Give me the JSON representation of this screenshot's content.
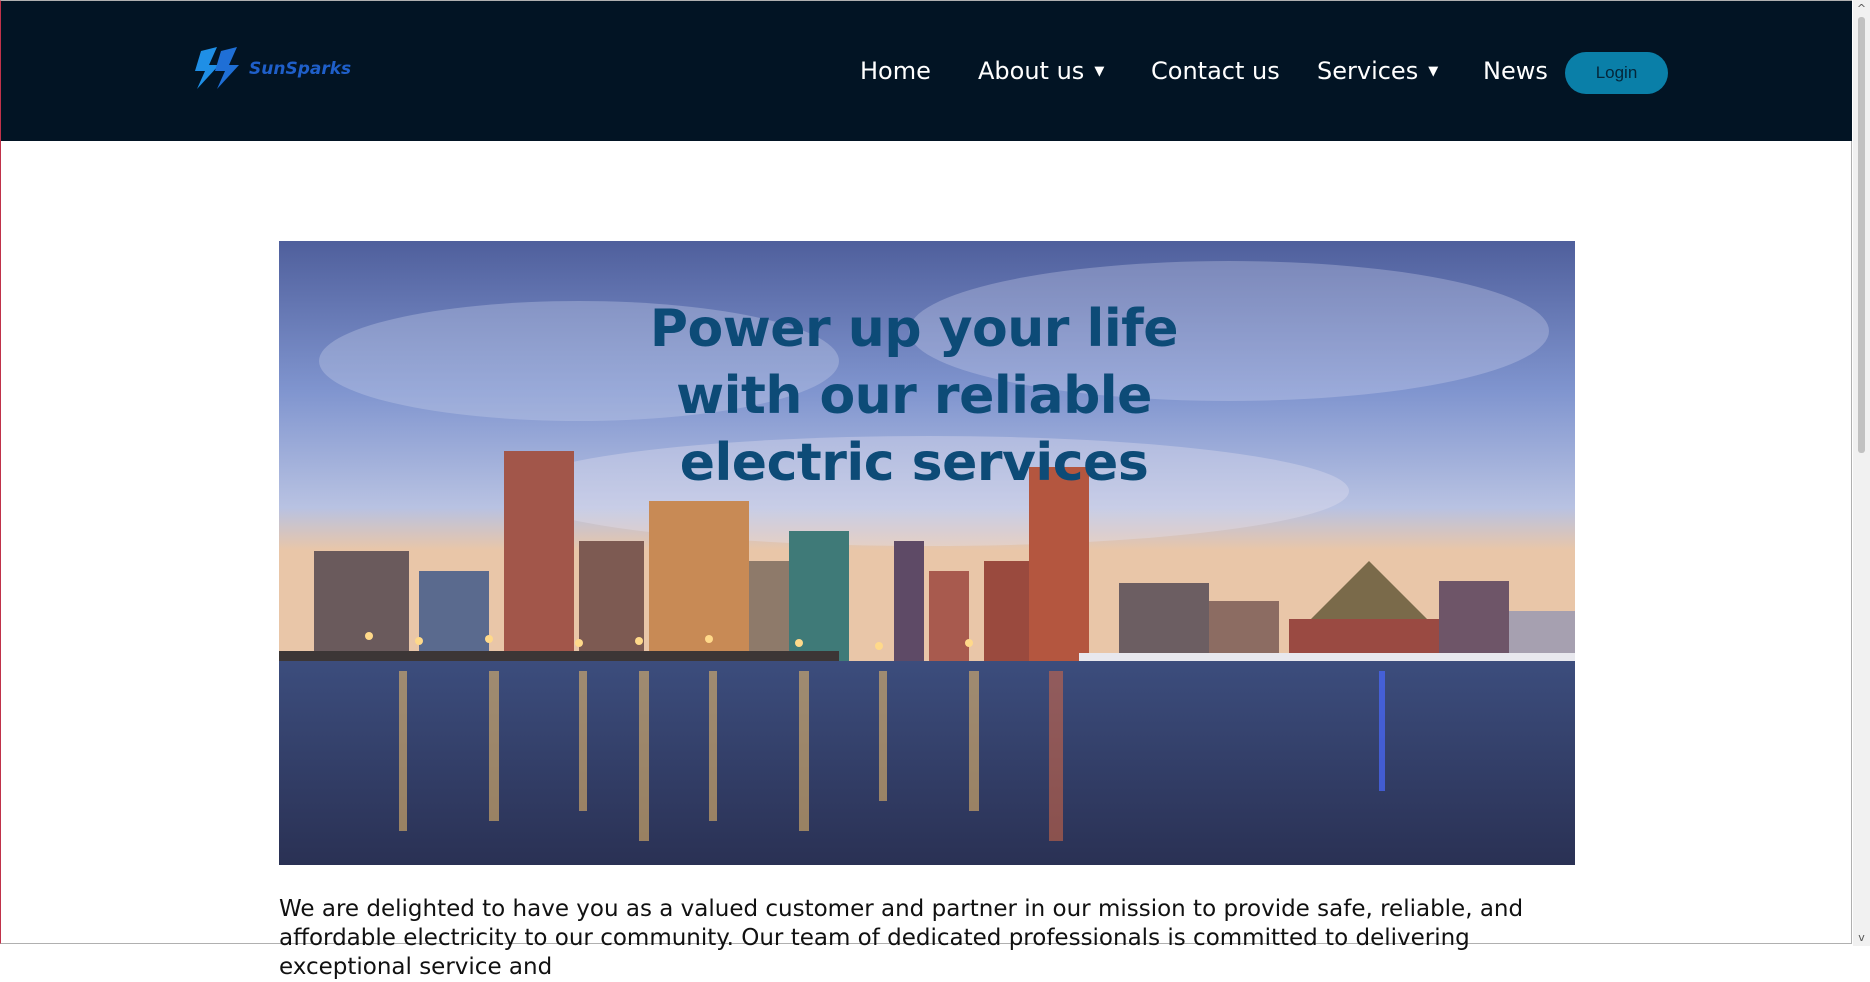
{
  "header": {
    "logo_text": "SunSparks",
    "nav": {
      "home": "Home",
      "about": "About us",
      "contact": "Contact us",
      "services": "Services",
      "news": "News"
    },
    "caret": "▼",
    "login_label": "Login"
  },
  "hero": {
    "title": "Power up your life with our reliable electric services"
  },
  "intro": {
    "text": "We are delighted to have you as a valued customer and partner in our mission to provide safe, reliable, and affordable electricity to our community. Our team of dedicated professionals is committed to delivering exceptional service and"
  },
  "scrollbar": {
    "up_icon": "chevron-up-icon",
    "down_icon": "chevron-down-icon",
    "up_glyph": "^",
    "down_glyph": "v"
  },
  "colors": {
    "navbar": "#021424",
    "login_button": "#0a7fa8",
    "hero_title": "#0d4b77"
  }
}
